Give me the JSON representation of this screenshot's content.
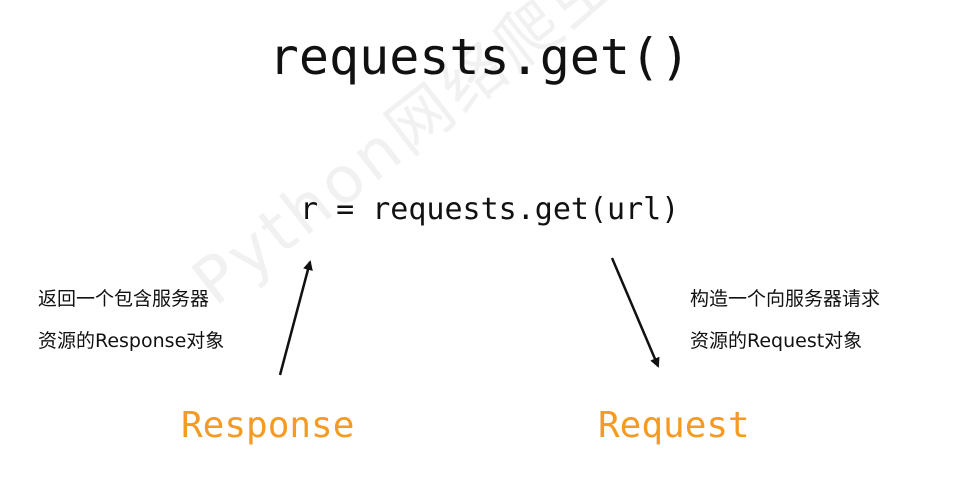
{
  "title": "requests.get()",
  "code_line": "r = requests.get(url)",
  "left_description": {
    "line1": "返回一个包含服务器",
    "line2": "资源的Response对象"
  },
  "right_description": {
    "line1": "构造一个向服务器请求",
    "line2": "资源的Request对象"
  },
  "left_object": "Response",
  "right_object": "Request",
  "watermark": "Python网络爬虫与信息提取",
  "colors": {
    "text": "#111111",
    "object_label": "#f59a23",
    "arrow": "#111111",
    "watermark": "#e6e6e6"
  }
}
